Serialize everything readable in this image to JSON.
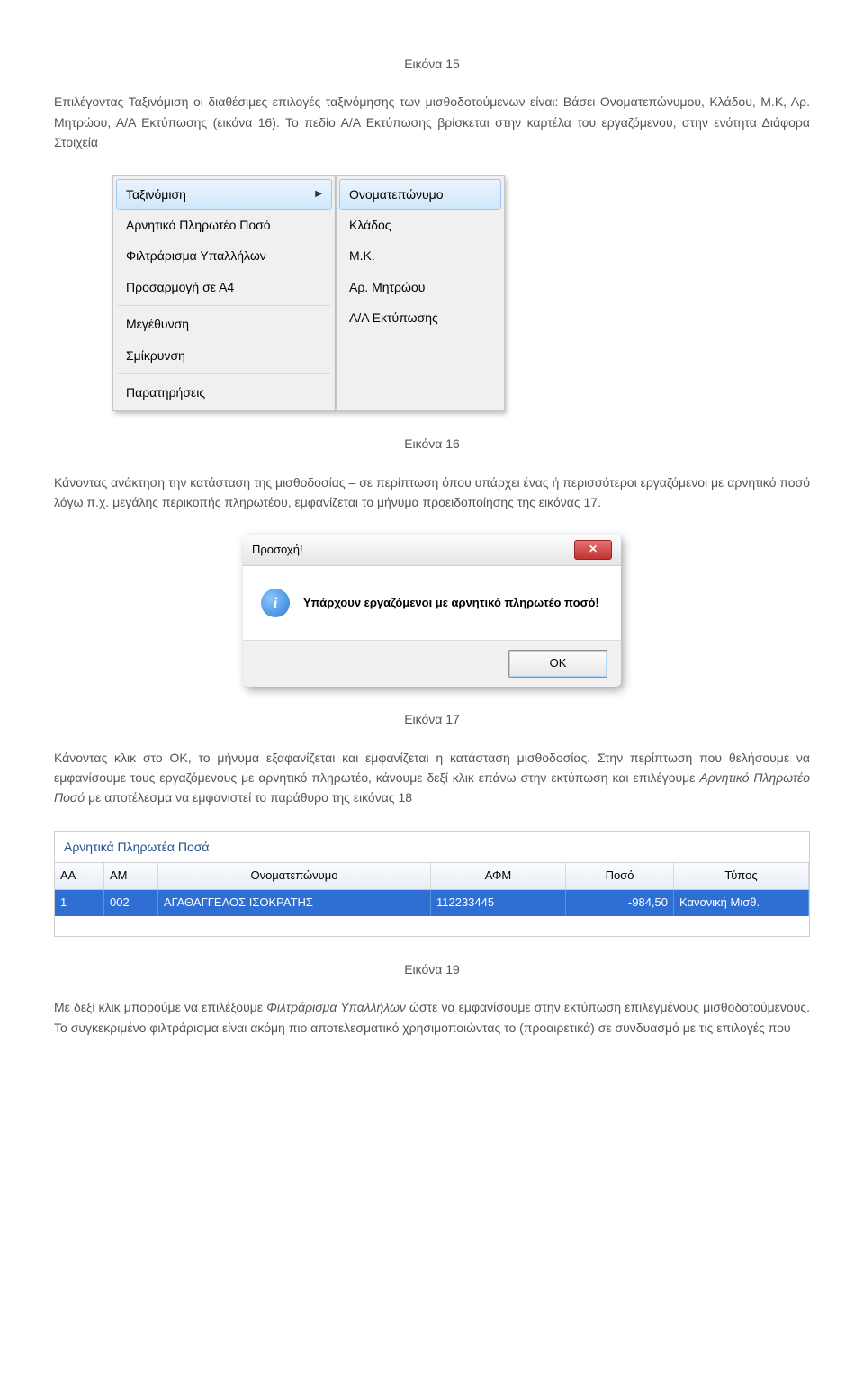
{
  "caption15": "Εικόνα 15",
  "p1": "Επιλέγοντας Ταξινόμιση οι διαθέσιμες επιλογές ταξινόμησης των μισθοδοτούμενων είναι: Βάσει Ονοματεπώνυμου, Κλάδου, Μ.Κ, Αρ. Μητρώου, Α/Α Εκτύπωσης (εικόνα 16). Το πεδίο Α/Α Εκτύπωσης βρίσκεται στην καρτέλα του εργαζόμενου, στην ενότητα Διάφορα Στοιχεία",
  "menu_left": {
    "items": [
      "Ταξινόμιση",
      "Αρνητικό Πληρωτέο Ποσό",
      "Φιλτράρισμα Υπαλλήλων",
      "Προσαρμογή σε Α4",
      "Μεγέθυνση",
      "Σμίκρυνση",
      "Παρατηρήσεις"
    ]
  },
  "menu_right": {
    "items": [
      "Ονοματεπώνυμο",
      "Κλάδος",
      "Μ.Κ.",
      "Αρ. Μητρώου",
      "Α/Α Εκτύπωσης"
    ]
  },
  "caption16": "Εικόνα 16",
  "p2": "Κάνοντας ανάκτηση την κατάσταση της μισθοδοσίας – σε περίπτωση όπου υπάρχει ένας ή περισσότεροι εργαζόμενοι με αρνητικό ποσό λόγω π.χ. μεγάλης περικοπής πληρωτέου, εμφανίζεται το μήνυμα προειδοποίησης της εικόνας 17.",
  "dialog": {
    "title": "Προσοχή!",
    "message": "Υπάρχουν εργαζόμενοι με αρνητικό πληρωτέο ποσό!",
    "ok": "OK",
    "close_glyph": "✕"
  },
  "caption17": "Εικόνα 17",
  "p3a": "Κάνοντας κλικ στο ΟΚ, το μήνυμα εξαφανίζεται και εμφανίζεται η κατάσταση μισθοδοσίας. Στην περίπτωση που θελήσουμε να εμφανίσουμε τους εργαζόμενους με αρνητικό πληρωτέο, κάνουμε δεξί κλικ επάνω στην εκτύπωση και επιλέγουμε ",
  "p3b": "Αρνητικό Πληρωτέο Ποσό",
  "p3c": " με αποτέλεσμα να εμφανιστεί το παράθυρο της εικόνας 18",
  "grid": {
    "title": "Αρνητικά Πληρωτέα Ποσά",
    "headers": {
      "aa": "ΑΑ",
      "am": "ΑΜ",
      "name": "Ονοματεπώνυμο",
      "afm": "ΑΦΜ",
      "poso": "Ποσό",
      "type": "Τύπος"
    },
    "row": {
      "aa": "1",
      "am": "002",
      "name": "ΑΓΑΘΑΓΓΕΛΟΣ ΙΣΟΚΡΑΤΗΣ",
      "afm": "112233445",
      "poso": "-984,50",
      "type": "Κανονική Μισθ."
    }
  },
  "caption19": "Εικόνα 19",
  "p4a": "Με δεξί κλικ μπορούμε να επιλέξουμε ",
  "p4b": "Φιλτράρισμα Υπαλλήλων",
  "p4c": " ώστε να εμφανίσουμε στην εκτύπωση επιλεγμένους μισθοδοτούμενους. Το συγκεκριμένο φιλτράρισμα είναι ακόμη πιο αποτελεσματικό χρησιμοποιώντας το (προαιρετικά) σε συνδυασμό με τις επιλογές που"
}
